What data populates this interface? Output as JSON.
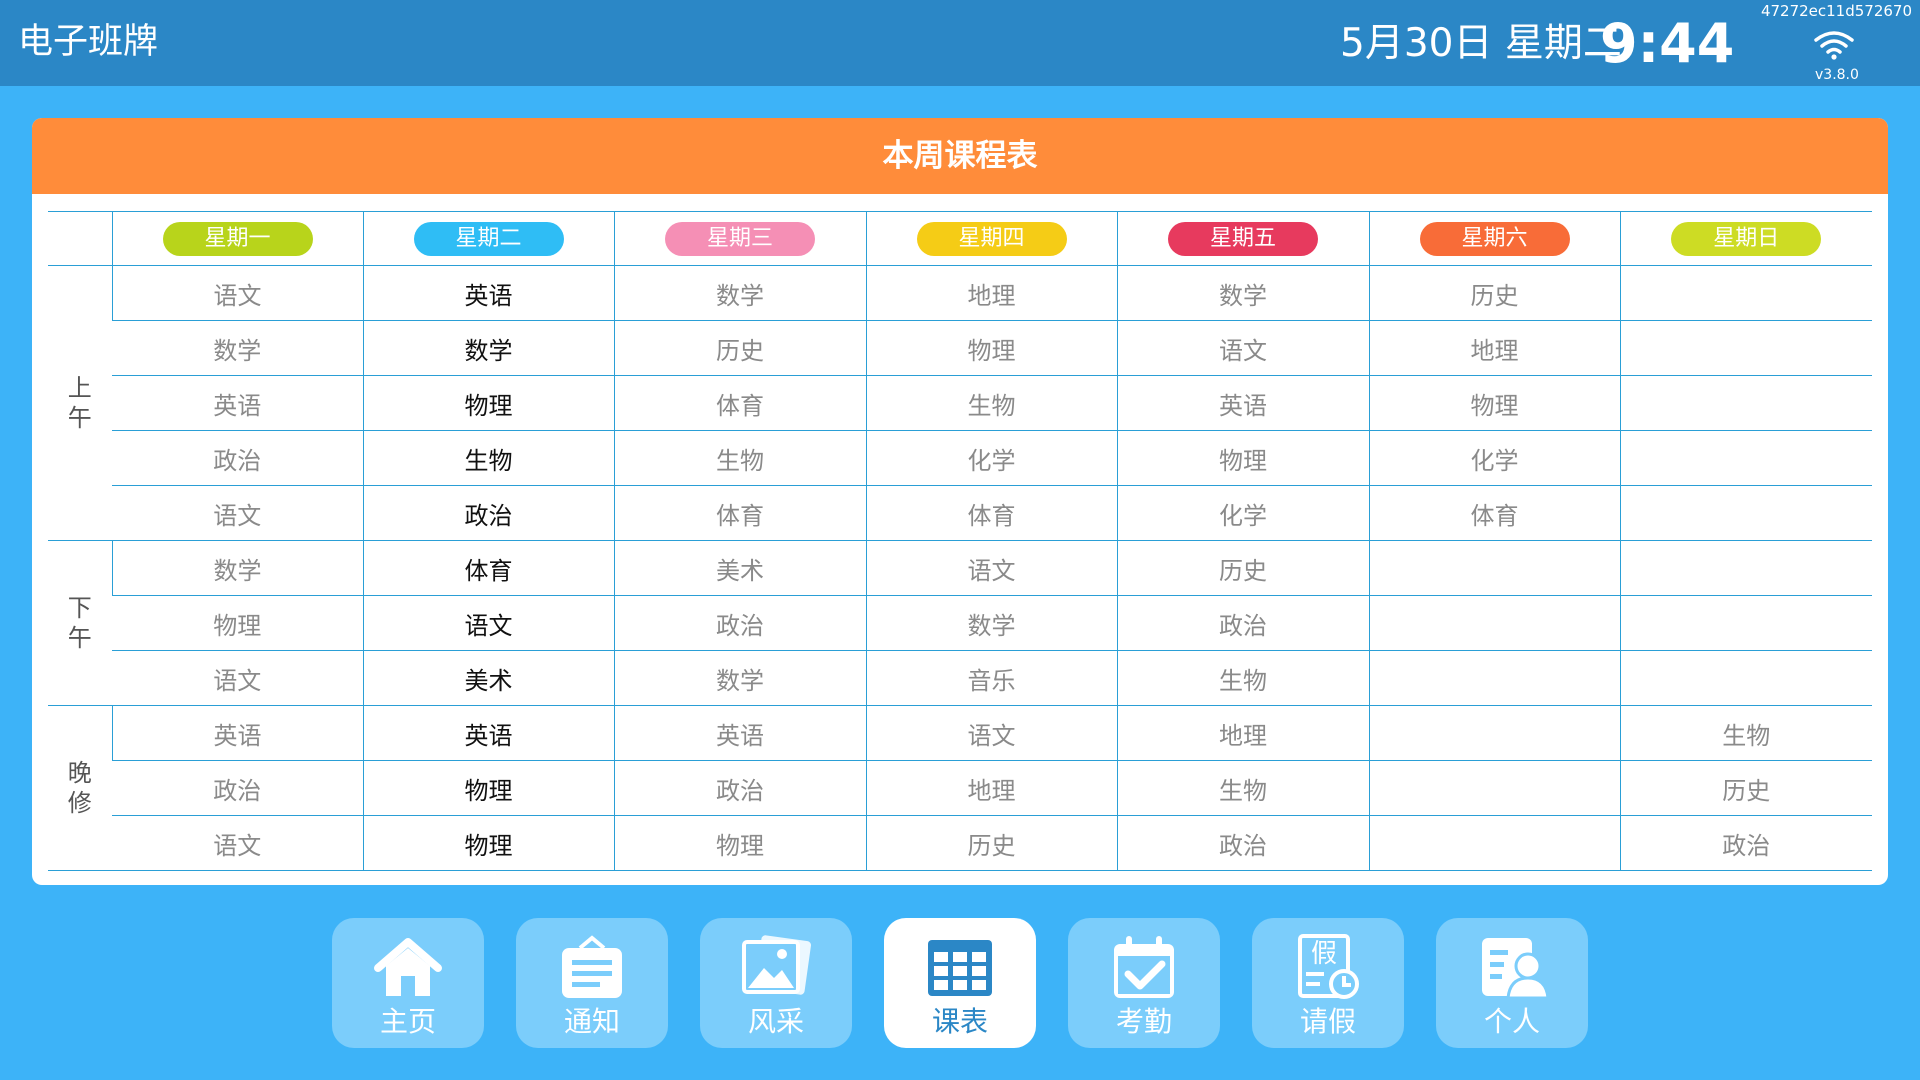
{
  "header": {
    "app_title": "电子班牌",
    "date": "5月30日 星期二",
    "time": "9:44",
    "device_id": "47272ec11d572670",
    "version": "v3.8.0",
    "wifi_icon": "wifi-icon"
  },
  "schedule": {
    "title": "本周课程表",
    "days": [
      {
        "label": "星期一",
        "color": "#b8d41b"
      },
      {
        "label": "星期二",
        "color": "#2fbdf5"
      },
      {
        "label": "星期三",
        "color": "#f58fb5"
      },
      {
        "label": "星期四",
        "color": "#f5cc16"
      },
      {
        "label": "星期五",
        "color": "#e73a5e"
      },
      {
        "label": "星期六",
        "color": "#f86c38"
      },
      {
        "label": "星期日",
        "color": "#cddc24"
      }
    ],
    "periods": [
      {
        "label": "上午",
        "rows": [
          [
            "语文",
            "英语",
            "数学",
            "地理",
            "数学",
            "历史",
            ""
          ],
          [
            "数学",
            "数学",
            "历史",
            "物理",
            "语文",
            "地理",
            ""
          ],
          [
            "英语",
            "物理",
            "体育",
            "生物",
            "英语",
            "物理",
            ""
          ],
          [
            "政治",
            "生物",
            "生物",
            "化学",
            "物理",
            "化学",
            ""
          ],
          [
            "语文",
            "政治",
            "体育",
            "体育",
            "化学",
            "体育",
            ""
          ]
        ]
      },
      {
        "label": "下午",
        "rows": [
          [
            "数学",
            "体育",
            "美术",
            "语文",
            "历史",
            "",
            ""
          ],
          [
            "物理",
            "语文",
            "政治",
            "数学",
            "政治",
            "",
            ""
          ],
          [
            "语文",
            "美术",
            "数学",
            "音乐",
            "生物",
            "",
            ""
          ]
        ]
      },
      {
        "label": "晚修",
        "rows": [
          [
            "英语",
            "英语",
            "英语",
            "语文",
            "地理",
            "",
            "生物"
          ],
          [
            "政治",
            "物理",
            "政治",
            "地理",
            "生物",
            "",
            "历史"
          ],
          [
            "语文",
            "物理",
            "物理",
            "历史",
            "政治",
            "",
            "政治"
          ]
        ]
      }
    ]
  },
  "nav": {
    "items": [
      {
        "label": "主页",
        "icon": "home-icon",
        "active": false
      },
      {
        "label": "通知",
        "icon": "notice-board-icon",
        "active": false
      },
      {
        "label": "风采",
        "icon": "photo-gallery-icon",
        "active": false
      },
      {
        "label": "课表",
        "icon": "timetable-icon",
        "active": true
      },
      {
        "label": "考勤",
        "icon": "calendar-check-icon",
        "active": false
      },
      {
        "label": "请假",
        "icon": "leave-request-icon",
        "active": false
      },
      {
        "label": "个人",
        "icon": "profile-card-icon",
        "active": false
      }
    ],
    "leave_icon_glyph": "假"
  }
}
